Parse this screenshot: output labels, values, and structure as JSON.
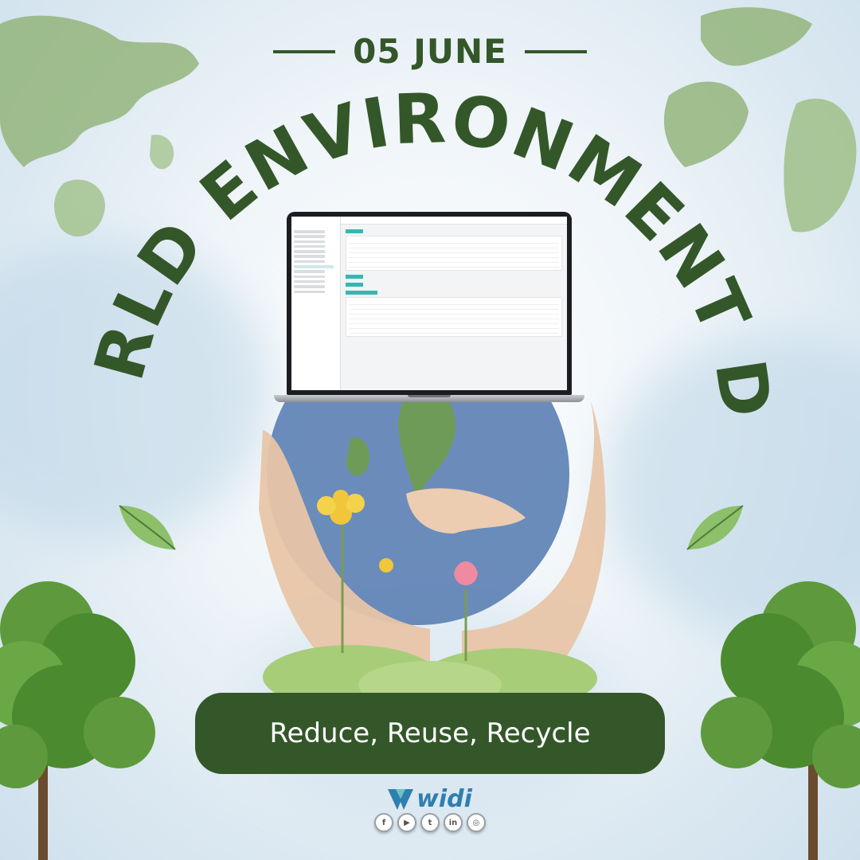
{
  "poster": {
    "date": "05 JUNE",
    "title": "WORLD ENVIRONMENT DAY",
    "slogan": "Reduce, Reuse, Recycle",
    "brand": "widi"
  },
  "socials": [
    {
      "name": "facebook-icon",
      "glyph": "f"
    },
    {
      "name": "youtube-icon",
      "glyph": "▶"
    },
    {
      "name": "twitter-icon",
      "glyph": "t"
    },
    {
      "name": "linkedin-icon",
      "glyph": "in"
    },
    {
      "name": "instagram-icon",
      "glyph": "◎"
    }
  ],
  "colors": {
    "dark_green": "#34572a",
    "leaf_green": "#7fb34f",
    "brand_blue": "#2f7fb0",
    "globe_blue": "#5b7fb4",
    "sky": "#dbe8f1"
  }
}
